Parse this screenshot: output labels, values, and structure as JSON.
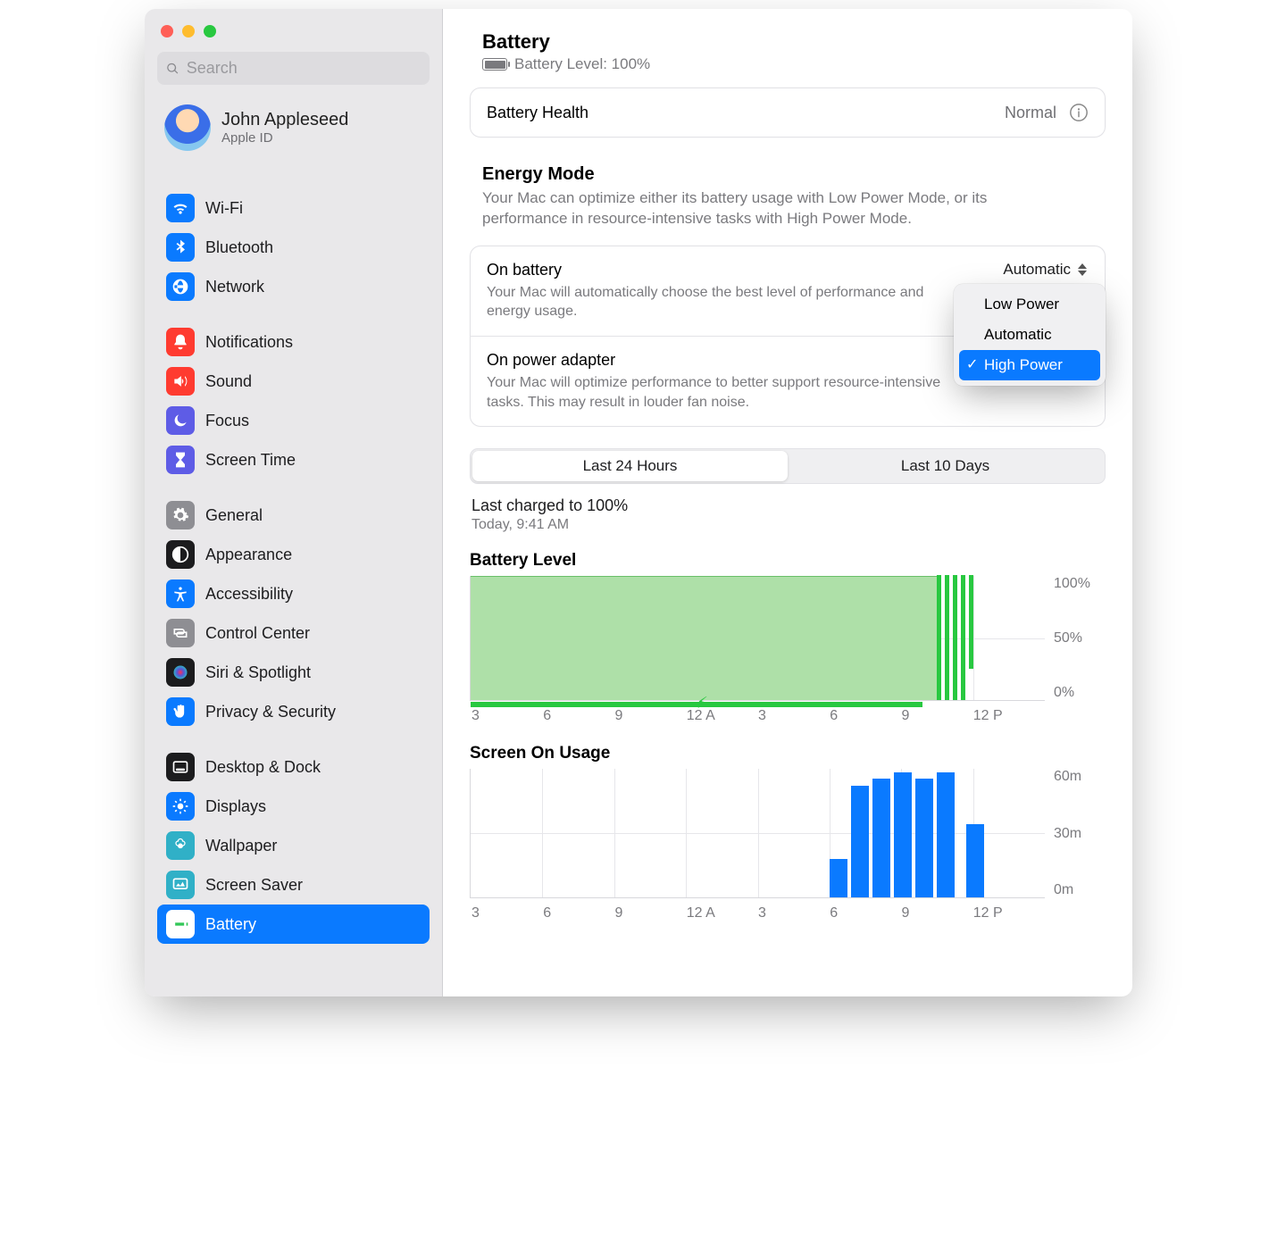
{
  "sidebar": {
    "search_placeholder": "Search",
    "account": {
      "name": "John Appleseed",
      "sub": "Apple ID"
    },
    "groups": [
      [
        {
          "label": "Wi-Fi",
          "icon": "wifi",
          "color": "ic-blue"
        },
        {
          "label": "Bluetooth",
          "icon": "bluetooth",
          "color": "ic-blue"
        },
        {
          "label": "Network",
          "icon": "globe",
          "color": "ic-blue"
        }
      ],
      [
        {
          "label": "Notifications",
          "icon": "bell",
          "color": "ic-red"
        },
        {
          "label": "Sound",
          "icon": "speaker",
          "color": "ic-red"
        },
        {
          "label": "Focus",
          "icon": "moon",
          "color": "ic-indigo"
        },
        {
          "label": "Screen Time",
          "icon": "hourglass",
          "color": "ic-indigo"
        }
      ],
      [
        {
          "label": "General",
          "icon": "gear",
          "color": "ic-grey"
        },
        {
          "label": "Appearance",
          "icon": "contrast",
          "color": "ic-black"
        },
        {
          "label": "Accessibility",
          "icon": "accessibility",
          "color": "ic-blue"
        },
        {
          "label": "Control Center",
          "icon": "switches",
          "color": "ic-grey"
        },
        {
          "label": "Siri & Spotlight",
          "icon": "siri",
          "color": "ic-black"
        },
        {
          "label": "Privacy & Security",
          "icon": "hand",
          "color": "ic-blue"
        }
      ],
      [
        {
          "label": "Desktop & Dock",
          "icon": "dock",
          "color": "ic-black"
        },
        {
          "label": "Displays",
          "icon": "sun",
          "color": "ic-blue"
        },
        {
          "label": "Wallpaper",
          "icon": "flower",
          "color": "ic-teal"
        },
        {
          "label": "Screen Saver",
          "icon": "screensaver",
          "color": "ic-teal"
        },
        {
          "label": "Battery",
          "icon": "battery",
          "color": "ic-green",
          "selected": true
        }
      ]
    ]
  },
  "header": {
    "title": "Battery",
    "level_label": "Battery Level: 100%"
  },
  "health_row": {
    "label": "Battery Health",
    "value": "Normal"
  },
  "energy_mode": {
    "title": "Energy Mode",
    "desc": "Your Mac can optimize either its battery usage with Low Power Mode, or its performance in resource-intensive tasks with High Power Mode.",
    "rows": [
      {
        "title": "On battery",
        "desc": "Your Mac will automatically choose the best level of performance and energy usage.",
        "value": "Automatic"
      },
      {
        "title": "On power adapter",
        "desc": "Your Mac will optimize performance to better support resource-intensive tasks. This may result in louder fan noise.",
        "value": "High Power"
      }
    ],
    "options": [
      "Low Power",
      "Automatic",
      "High Power"
    ],
    "selected_option": "High Power"
  },
  "segmented": {
    "a": "Last 24 Hours",
    "b": "Last 10 Days"
  },
  "charged": {
    "line1": "Last charged to 100%",
    "line2": "Today, 9:41 AM"
  },
  "chart_data": [
    {
      "type": "area",
      "title": "Battery Level",
      "x_ticks": [
        "3",
        "6",
        "9",
        "12 A",
        "3",
        "6",
        "9",
        "12 P"
      ],
      "y_ticks": [
        "100%",
        "50%",
        "0%"
      ],
      "ylim": [
        0,
        100
      ],
      "charging_until_index": 6.3,
      "level_until_index": 6.5,
      "bars_after": [
        100,
        100,
        100,
        100,
        75
      ],
      "values_note": "Battery at 100% from 3PM to ~9:40AM while charging, then on battery with brief 100% bars."
    },
    {
      "type": "bar",
      "title": "Screen On Usage",
      "x_ticks": [
        "3",
        "6",
        "9",
        "12 A",
        "3",
        "6",
        "9",
        "12 P"
      ],
      "y_ticks": [
        "60m",
        "30m",
        "0m"
      ],
      "ylim": [
        0,
        60
      ],
      "bars": [
        {
          "slot": 5.0,
          "value": 18
        },
        {
          "slot": 5.3,
          "value": 52
        },
        {
          "slot": 5.6,
          "value": 55
        },
        {
          "slot": 5.9,
          "value": 58
        },
        {
          "slot": 6.2,
          "value": 55
        },
        {
          "slot": 6.5,
          "value": 58
        },
        {
          "slot": 6.9,
          "value": 34
        }
      ]
    }
  ]
}
